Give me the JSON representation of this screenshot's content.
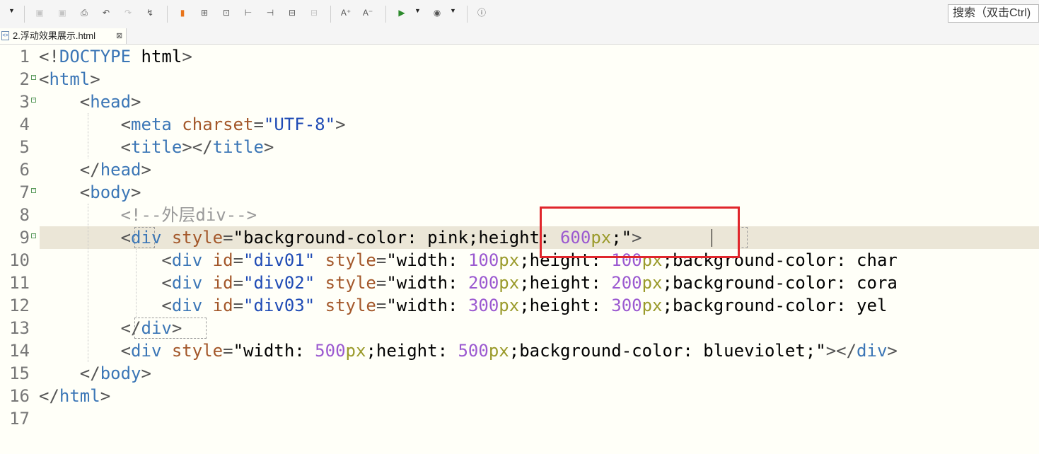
{
  "toolbar": {
    "icons": [
      "dropdown-arrow",
      "save-icon",
      "save-all-icon",
      "print-icon",
      "undo-icon",
      "redo-icon",
      "format-icon",
      "bookmark-icon",
      "new-file-icon",
      "export-icon",
      "indent-left-icon",
      "indent-right-icon",
      "comment-icon",
      "uncomment-icon",
      "font-increase-icon",
      "font-decrease-icon",
      "run-icon",
      "browser-icon",
      "info-icon"
    ],
    "search_placeholder": "搜索（双击Ctrl)"
  },
  "tab": {
    "label": "2.浮动效果展示.html",
    "close": "⊠"
  },
  "editor": {
    "line_numbers": [
      "1",
      "2",
      "3",
      "4",
      "5",
      "6",
      "7",
      "8",
      "9",
      "10",
      "11",
      "12",
      "13",
      "14",
      "15",
      "16",
      "17"
    ],
    "lines": [
      "<!DOCTYPE html>",
      "<html>",
      "    <head>",
      "        <meta charset=\"UTF-8\">",
      "        <title></title>",
      "    </head>",
      "    <body>",
      "        <!--外层div-->",
      "        <div style=\"background-color: pink;height: 600px;\">",
      "            <div id=\"div01\" style=\"width: 100px;height: 100px;background-color: char",
      "            <div id=\"div02\" style=\"width: 200px;height: 200px;background-color: cora",
      "            <div id=\"div03\" style=\"width: 300px;height: 300px;background-color: yel",
      "        </div>",
      "        <div style=\"width: 500px;height: 500px;background-color: blueviolet;\"></div>",
      "    </body>",
      "</html>",
      ""
    ]
  }
}
